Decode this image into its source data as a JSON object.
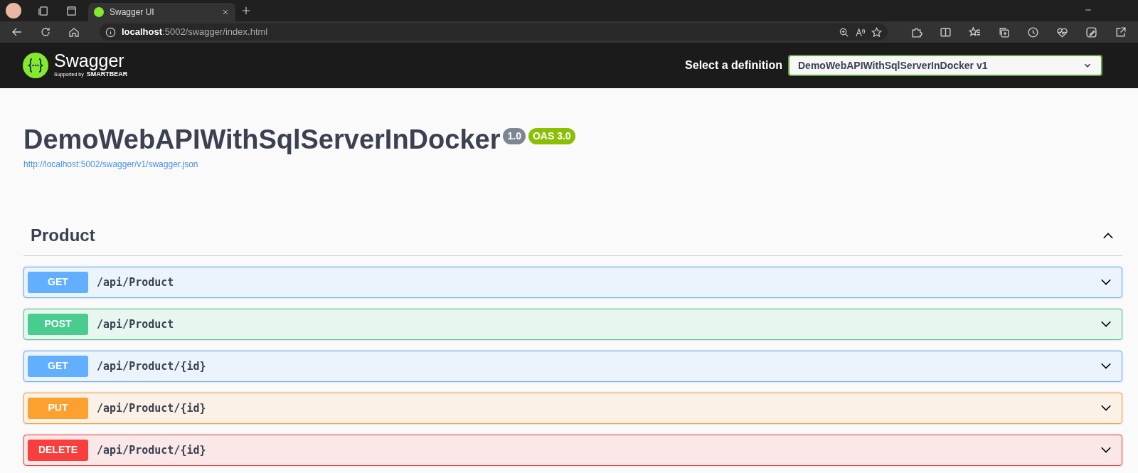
{
  "browser": {
    "tab": {
      "title": "Swagger UI",
      "selected": true
    },
    "address": {
      "host": "localhost",
      "path": ":5002/swagger/index.html"
    }
  },
  "header": {
    "logo_text": "Swagger",
    "logo_subtext": "Supported by",
    "logo_brand": "SMARTBEAR",
    "definition_label": "Select a definition",
    "definition_value": "DemoWebAPIWithSqlServerInDocker v1"
  },
  "info": {
    "title": "DemoWebAPIWithSqlServerInDocker",
    "version": "1.0",
    "oas": "OAS 3.0",
    "spec_url": "http://localhost:5002/swagger/v1/swagger.json"
  },
  "section": {
    "name": "Product",
    "expanded": true,
    "operations": [
      {
        "method": "GET",
        "path": "/api/Product",
        "expanded": false
      },
      {
        "method": "POST",
        "path": "/api/Product",
        "expanded": false
      },
      {
        "method": "GET",
        "path": "/api/Product/{id}",
        "expanded": false
      },
      {
        "method": "PUT",
        "path": "/api/Product/{id}",
        "expanded": false
      },
      {
        "method": "DELETE",
        "path": "/api/Product/{id}",
        "expanded": false
      }
    ]
  }
}
